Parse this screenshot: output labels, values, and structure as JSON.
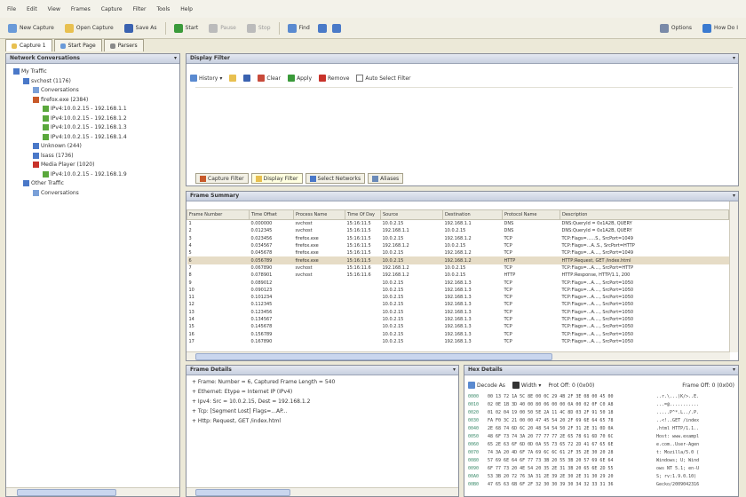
{
  "menubar": [
    "File",
    "Edit",
    "View",
    "Frames",
    "Capture",
    "Filter",
    "Tools",
    "Help"
  ],
  "toolbar": {
    "new_capture": "New Capture",
    "open_capture": "Open Capture",
    "save_as": "Save As",
    "start": "Start",
    "pause": "Pause",
    "stop": "Stop",
    "find": "Find",
    "options": "Options",
    "how_do_i": "How Do I"
  },
  "doc_tabs": [
    {
      "label": "Capture 1"
    },
    {
      "label": "Start Page"
    },
    {
      "label": "Parsers"
    }
  ],
  "network_conversations": {
    "title": "Network Conversations",
    "items": [
      {
        "label": "My Traffic",
        "level": 0,
        "color": "#4a78c8"
      },
      {
        "label": "svchost (1176)",
        "level": 1,
        "color": "#4a78c8"
      },
      {
        "label": "Conversations",
        "level": 2,
        "color": "#7aa0d8"
      },
      {
        "label": "firefox.exe (2384)",
        "level": 2,
        "color": "#c85a2a"
      },
      {
        "label": "IPv4:10.0.2.15 - 192.168.1.1",
        "level": 3,
        "color": "#5aa83c"
      },
      {
        "label": "IPv4:10.0.2.15 - 192.168.1.2",
        "level": 3,
        "color": "#5aa83c"
      },
      {
        "label": "IPv4:10.0.2.15 - 192.168.1.3",
        "level": 3,
        "color": "#5aa83c"
      },
      {
        "label": "IPv4:10.0.2.15 - 192.168.1.4",
        "level": 3,
        "color": "#5aa83c"
      },
      {
        "label": "Unknown (244)",
        "level": 2,
        "color": "#4a78c8"
      },
      {
        "label": "lsass (1736)",
        "level": 2,
        "color": "#4a78c8"
      },
      {
        "label": "Media Player (1020)",
        "level": 2,
        "color": "#c8322a"
      },
      {
        "label": "IPv4:10.0.2.15 - 192.168.1.9",
        "level": 3,
        "color": "#5aa83c"
      },
      {
        "label": "Other Traffic",
        "level": 1,
        "color": "#4a78c8"
      },
      {
        "label": "Conversations",
        "level": 2,
        "color": "#7aa0d8"
      }
    ]
  },
  "display_filter": {
    "title": "Display Filter",
    "history": "History",
    "load_filter": "Load Filter",
    "save": "Save",
    "clear": "Clear",
    "apply": "Apply",
    "remove": "Remove",
    "autoselect": "Auto Select Filter",
    "tabs": [
      "Capture Filter",
      "Display Filter",
      "Select Networks",
      "Aliases"
    ]
  },
  "frame_summary": {
    "title": "Frame Summary",
    "columns": [
      "Frame Number",
      "Time Offset",
      "Process Name",
      "Time Of Day",
      "Source",
      "Destination",
      "Protocol Name",
      "Description"
    ],
    "rows": [
      [
        "1",
        "0.000000",
        "svchost",
        "15:16:11.5",
        "10.0.2.15",
        "192.168.1.1",
        "DNS",
        "DNS:QueryId = 0x1A2B, QUERY"
      ],
      [
        "2",
        "0.012345",
        "svchost",
        "15:16:11.5",
        "192.168.1.1",
        "10.0.2.15",
        "DNS",
        "DNS:QueryId = 0x1A2B, QUERY"
      ],
      [
        "3",
        "0.023456",
        "firefox.exe",
        "15:16:11.5",
        "10.0.2.15",
        "192.168.1.2",
        "TCP",
        "TCP:Flags=......S., SrcPort=1049"
      ],
      [
        "4",
        "0.034567",
        "firefox.exe",
        "15:16:11.5",
        "192.168.1.2",
        "10.0.2.15",
        "TCP",
        "TCP:Flags=...A..S., SrcPort=HTTP"
      ],
      [
        "5",
        "0.045678",
        "firefox.exe",
        "15:16:11.5",
        "10.0.2.15",
        "192.168.1.2",
        "TCP",
        "TCP:Flags=...A...., SrcPort=1049"
      ],
      [
        "6",
        "0.056789",
        "firefox.exe",
        "15:16:11.5",
        "10.0.2.15",
        "192.168.1.2",
        "HTTP",
        "HTTP:Request, GET /index.html"
      ],
      [
        "7",
        "0.067890",
        "svchost",
        "15:16:11.6",
        "192.168.1.2",
        "10.0.2.15",
        "TCP",
        "TCP:Flags=...A...., SrcPort=HTTP"
      ],
      [
        "8",
        "0.078901",
        "svchost",
        "15:16:11.6",
        "192.168.1.2",
        "10.0.2.15",
        "HTTP",
        "HTTP:Response, HTTP/1.1, 200"
      ],
      [
        "9",
        "0.089012",
        "",
        "",
        "10.0.2.15",
        "192.168.1.3",
        "TCP",
        "TCP:Flags=...A...., SrcPort=1050"
      ],
      [
        "10",
        "0.090123",
        "",
        "",
        "10.0.2.15",
        "192.168.1.3",
        "TCP",
        "TCP:Flags=...A...., SrcPort=1050"
      ],
      [
        "11",
        "0.101234",
        "",
        "",
        "10.0.2.15",
        "192.168.1.3",
        "TCP",
        "TCP:Flags=...A...., SrcPort=1050"
      ],
      [
        "12",
        "0.112345",
        "",
        "",
        "10.0.2.15",
        "192.168.1.3",
        "TCP",
        "TCP:Flags=...A...., SrcPort=1050"
      ],
      [
        "13",
        "0.123456",
        "",
        "",
        "10.0.2.15",
        "192.168.1.3",
        "TCP",
        "TCP:Flags=...A...., SrcPort=1050"
      ],
      [
        "14",
        "0.134567",
        "",
        "",
        "10.0.2.15",
        "192.168.1.3",
        "TCP",
        "TCP:Flags=...A...., SrcPort=1050"
      ],
      [
        "15",
        "0.145678",
        "",
        "",
        "10.0.2.15",
        "192.168.1.3",
        "TCP",
        "TCP:Flags=...A...., SrcPort=1050"
      ],
      [
        "16",
        "0.156789",
        "",
        "",
        "10.0.2.15",
        "192.168.1.3",
        "TCP",
        "TCP:Flags=...A...., SrcPort=1050"
      ],
      [
        "17",
        "0.167890",
        "",
        "",
        "10.0.2.15",
        "192.168.1.3",
        "TCP",
        "TCP:Flags=...A...., SrcPort=1050"
      ]
    ]
  },
  "frame_details": {
    "title": "Frame Details",
    "lines": [
      "+ Frame: Number = 6, Captured Frame Length = 540",
      "+ Ethernet: Etype = Internet IP (IPv4)",
      "+ Ipv4: Src = 10.0.2.15, Dest = 192.168.1.2",
      "+ Tcp: [Segment Lost] Flags=...AP...",
      "+ Http: Request, GET /index.html"
    ]
  },
  "hex_details": {
    "title": "Hex Details",
    "decode_as": "Decode As",
    "width": "Width",
    "prot_offset": "Prot Off: 0 (0x00)",
    "frame_offset": "Frame Off: 0 (0x00)",
    "rows": [
      {
        "off": "0000",
        "bytes": "00 13 72 1A 5C 8E 00 0C 29 4B 2F 3E 08 00 45 00",
        "ascii": "..r.\\...)K/>..E."
      },
      {
        "off": "0010",
        "bytes": "02 0E 1B 3D 40 00 80 06 00 00 0A 00 02 0F C0 A8",
        "ascii": "...=@..........."
      },
      {
        "off": "0020",
        "bytes": "01 02 04 19 00 50 5E 2A 11 4C 8D 03 2F 91 50 18",
        "ascii": ".....P^*.L../.P."
      },
      {
        "off": "0030",
        "bytes": "FA F0 3C 21 00 00 47 45 54 20 2F 69 6E 64 65 78",
        "ascii": "..<!..GET /index"
      },
      {
        "off": "0040",
        "bytes": "2E 68 74 6D 6C 20 48 54 54 50 2F 31 2E 31 0D 0A",
        "ascii": ".html HTTP/1.1.."
      },
      {
        "off": "0050",
        "bytes": "48 6F 73 74 3A 20 77 77 77 2E 65 78 61 6D 70 6C",
        "ascii": "Host: www.exampl"
      },
      {
        "off": "0060",
        "bytes": "65 2E 63 6F 6D 0D 0A 55 73 65 72 2D 41 67 65 6E",
        "ascii": "e.com..User-Agen"
      },
      {
        "off": "0070",
        "bytes": "74 3A 20 4D 6F 7A 69 6C 6C 61 2F 35 2E 30 20 28",
        "ascii": "t: Mozilla/5.0 ("
      },
      {
        "off": "0080",
        "bytes": "57 69 6E 64 6F 77 73 3B 20 55 3B 20 57 69 6E 64",
        "ascii": "Windows; U; Wind"
      },
      {
        "off": "0090",
        "bytes": "6F 77 73 20 4E 54 20 35 2E 31 3B 20 65 6E 2D 55",
        "ascii": "ows NT 5.1; en-U"
      },
      {
        "off": "00A0",
        "bytes": "53 3B 20 72 76 3A 31 2E 39 2E 30 2E 31 30 29 20",
        "ascii": "S; rv:1.9.0.10) "
      },
      {
        "off": "00B0",
        "bytes": "47 65 63 6B 6F 2F 32 30 30 39 30 34 32 33 31 36",
        "ascii": "Gecko/2009042316"
      }
    ]
  }
}
